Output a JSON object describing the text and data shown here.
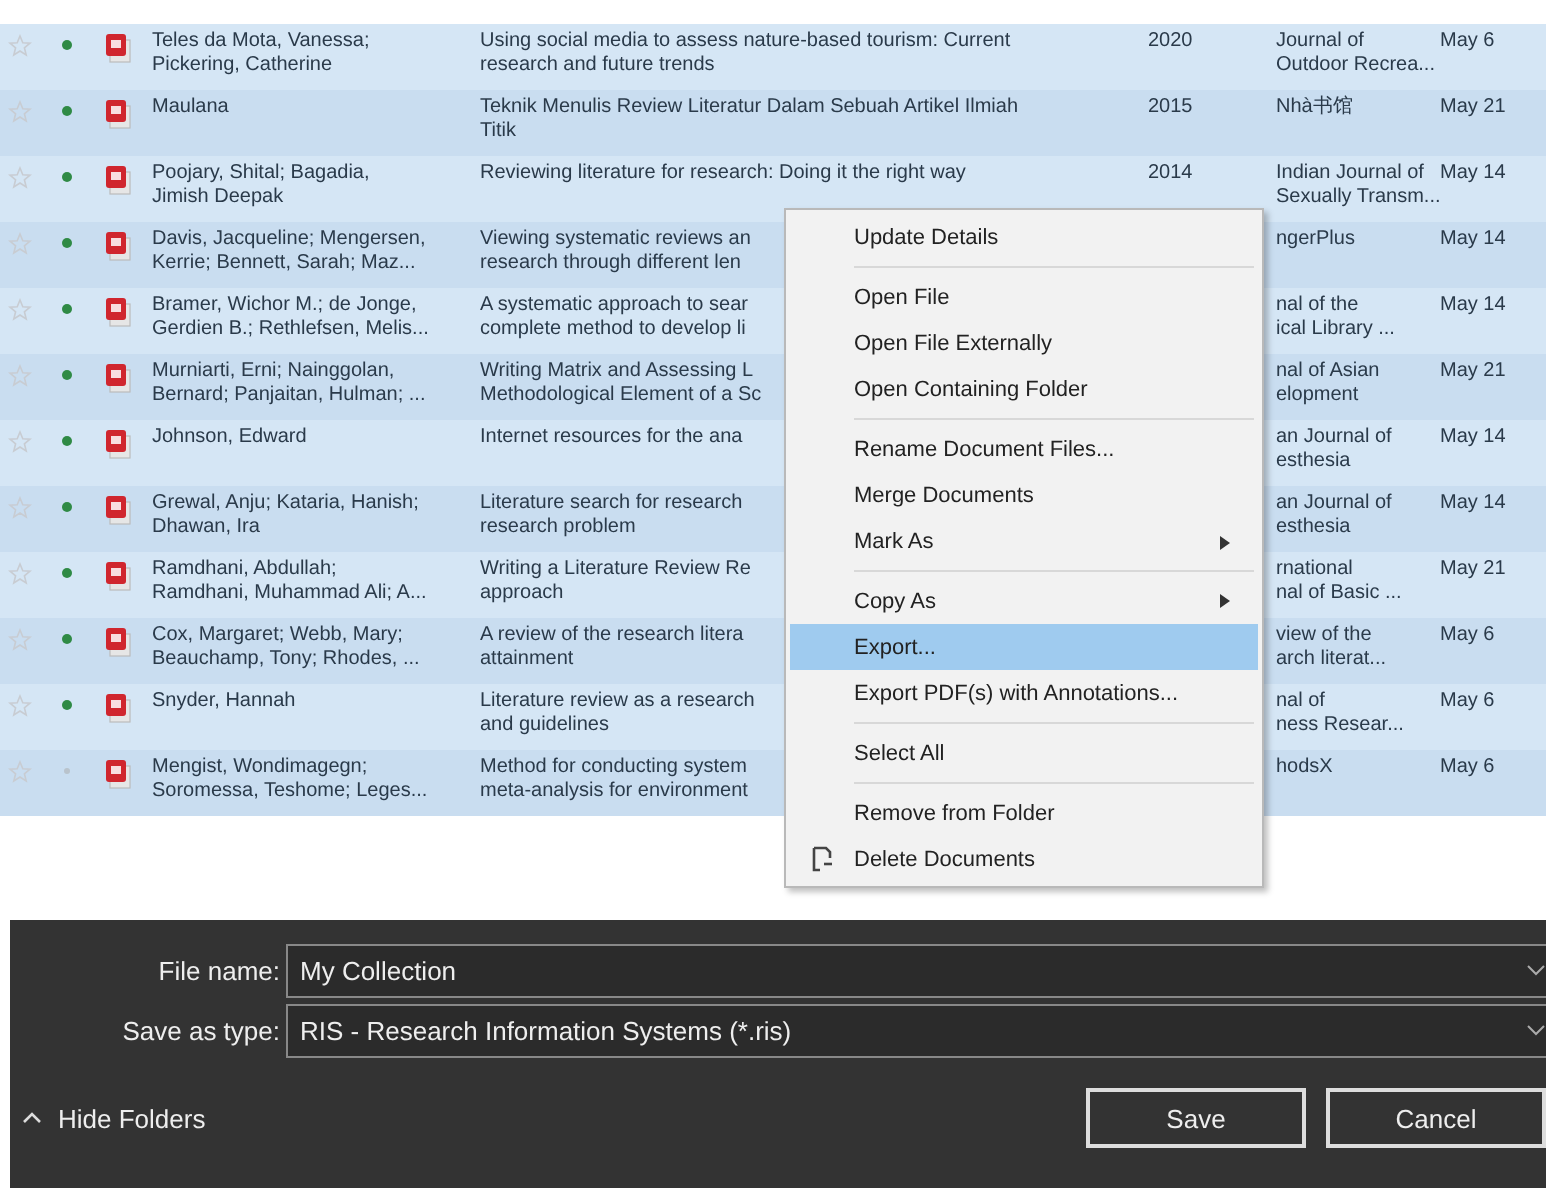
{
  "references": [
    {
      "starred": false,
      "read": true,
      "authors": [
        "Teles da Mota, Vanessa;",
        "Pickering, Catherine"
      ],
      "title": [
        "Using social media to assess nature-based tourism: Current",
        "research and future trends"
      ],
      "year": "2020",
      "journal": [
        "Journal of",
        "Outdoor Recrea..."
      ],
      "added": "May 6"
    },
    {
      "starred": false,
      "read": true,
      "authors": [
        "Maulana"
      ],
      "title": [
        "Teknik Menulis Review Literatur Dalam Sebuah Artikel Ilmiah",
        "Titik"
      ],
      "year": "2015",
      "journal": [
        "Nhà书馆"
      ],
      "added": "May 21"
    },
    {
      "starred": false,
      "read": true,
      "authors": [
        "Poojary, Shital; Bagadia,",
        "Jimish Deepak"
      ],
      "title": [
        "Reviewing literature for research: Doing it the right way"
      ],
      "year": "2014",
      "journal": [
        "Indian Journal of",
        "Sexually Transm..."
      ],
      "added": "May 14"
    },
    {
      "starred": false,
      "read": true,
      "authors": [
        "Davis, Jacqueline; Mengersen,",
        "Kerrie; Bennett, Sarah; Maz..."
      ],
      "title": [
        "Viewing systematic reviews an",
        "research through different len"
      ],
      "journal": [
        "ngerPlus"
      ],
      "added": "May 14"
    },
    {
      "starred": false,
      "read": true,
      "authors": [
        "Bramer, Wichor M.; de Jonge,",
        "Gerdien B.; Rethlefsen, Melis..."
      ],
      "title": [
        "A systematic approach to sear",
        "complete method to develop li"
      ],
      "journal": [
        "nal of the",
        "ical Library ..."
      ],
      "added": "May 14"
    },
    {
      "starred": false,
      "read": true,
      "authors": [
        "Murniarti, Erni; Nainggolan,",
        "Bernard; Panjaitan, Hulman; ..."
      ],
      "title": [
        "Writing Matrix and Assessing L",
        "Methodological Element of a Sc"
      ],
      "journal": [
        "nal of Asian",
        "elopment"
      ],
      "added": "May 21"
    },
    {
      "starred": false,
      "read": true,
      "authors": [
        "Johnson, Edward"
      ],
      "title": [
        "Internet resources for the ana"
      ],
      "journal": [
        "an Journal of",
        "esthesia"
      ],
      "added": "May 14"
    },
    {
      "starred": false,
      "read": true,
      "authors": [
        "Grewal, Anju; Kataria, Hanish;",
        "Dhawan, Ira"
      ],
      "title": [
        "Literature search for research",
        "research problem"
      ],
      "journal": [
        "an Journal of",
        "esthesia"
      ],
      "added": "May 14"
    },
    {
      "starred": false,
      "read": true,
      "authors": [
        "Ramdhani, Abdullah;",
        "Ramdhani, Muhammad Ali; A..."
      ],
      "title": [
        "Writing a Literature Review Re",
        "approach"
      ],
      "journal": [
        "rnational",
        "nal of Basic ..."
      ],
      "added": "May 21"
    },
    {
      "starred": false,
      "read": true,
      "authors": [
        "Cox, Margaret; Webb, Mary;",
        "Beauchamp, Tony; Rhodes, ..."
      ],
      "title": [
        "A review of the research litera",
        "attainment"
      ],
      "journal": [
        "view of the",
        "arch literat..."
      ],
      "added": "May 6"
    },
    {
      "starred": false,
      "read": true,
      "authors": [
        "Snyder, Hannah"
      ],
      "title": [
        "Literature review as a research",
        "and guidelines"
      ],
      "journal": [
        "nal of",
        "ness Resear..."
      ],
      "added": "May 6"
    },
    {
      "starred": false,
      "read": false,
      "authors": [
        "Mengist, Wondimagegn;",
        "Soromessa, Teshome; Leges..."
      ],
      "title": [
        "Method for conducting system",
        "meta-analysis for environment"
      ],
      "journal": [
        "hodsX"
      ],
      "added": "May 6"
    }
  ],
  "context_menu": [
    {
      "label": "Update Details",
      "selected": false,
      "submenu": false,
      "separator_after": true
    },
    {
      "label": "Open File",
      "selected": false,
      "submenu": false,
      "separator_after": false
    },
    {
      "label": "Open File Externally",
      "selected": false,
      "submenu": false,
      "separator_after": false
    },
    {
      "label": "Open Containing Folder",
      "selected": false,
      "submenu": false,
      "separator_after": true
    },
    {
      "label": "Rename Document Files...",
      "selected": false,
      "submenu": false,
      "separator_after": false
    },
    {
      "label": "Merge Documents",
      "selected": false,
      "submenu": false,
      "separator_after": false
    },
    {
      "label": "Mark As",
      "selected": false,
      "submenu": true,
      "separator_after": true
    },
    {
      "label": "Copy As",
      "selected": false,
      "submenu": true,
      "separator_after": false
    },
    {
      "label": "Export...",
      "selected": true,
      "submenu": false,
      "separator_after": false
    },
    {
      "label": "Export PDF(s) with Annotations...",
      "selected": false,
      "submenu": false,
      "separator_after": true
    },
    {
      "label": "Select All",
      "selected": false,
      "submenu": false,
      "separator_after": true
    },
    {
      "label": "Remove from Folder",
      "selected": false,
      "submenu": false,
      "separator_after": false
    },
    {
      "label": "Delete Documents",
      "selected": false,
      "submenu": false,
      "separator_after": false,
      "icon": true
    }
  ],
  "save_dialog": {
    "file_name_label": "File name:",
    "file_name": "My Collection",
    "type_label": "Save as type:",
    "type": "RIS - Research Information Systems (*.ris)",
    "hide_folders": "Hide Folders",
    "buttons": [
      "Save",
      "Cancel"
    ]
  }
}
